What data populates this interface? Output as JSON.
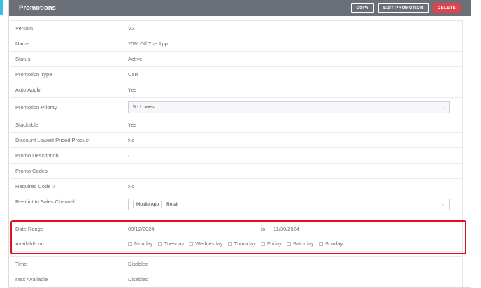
{
  "header": {
    "title": "Promotions",
    "copy_label": "COPY",
    "edit_label": "EDIT PROMOTION",
    "delete_label": "DELETE"
  },
  "rows": {
    "version": {
      "label": "Version",
      "value": "V2"
    },
    "name": {
      "label": "Name",
      "value": "20% Off The App"
    },
    "status": {
      "label": "Status",
      "value": "Active"
    },
    "type": {
      "label": "Promotion Type",
      "value": "Cart"
    },
    "auto_apply": {
      "label": "Auto Apply",
      "value": "Yes"
    },
    "priority": {
      "label": "Promotion Priority",
      "value": "5 - Lowest"
    },
    "stackable": {
      "label": "Stackable",
      "value": "Yes"
    },
    "discount_lowest": {
      "label": "Discount Lowest Priced Product",
      "value": "No"
    },
    "description": {
      "label": "Promo Description",
      "value": "-"
    },
    "codes": {
      "label": "Promo Codes",
      "value": "-"
    },
    "required_code": {
      "label": "Required Code ?",
      "value": "No"
    },
    "sales_channel": {
      "label": "Restrict to Sales Channel",
      "tags": [
        "Mobile App",
        "Retail"
      ]
    },
    "date_range": {
      "label": "Date Range",
      "from": "08/12/2024",
      "to_label": "to",
      "to": "11/30/2024"
    },
    "available_on": {
      "label": "Available on",
      "days": [
        "Monday",
        "Tuesday",
        "Wednesday",
        "Thursday",
        "Friday",
        "Saturday",
        "Sunday"
      ]
    },
    "time": {
      "label": "Time",
      "value": "Disabled"
    },
    "max_available": {
      "label": "Max Available",
      "value": "Disabled"
    }
  }
}
